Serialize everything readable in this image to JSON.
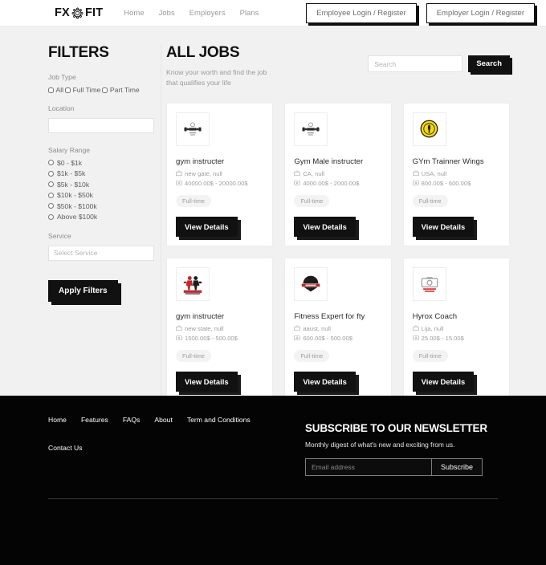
{
  "header": {
    "logo": {
      "left": "FX",
      "right": "FIT",
      "icon": "gear-icon"
    },
    "nav": [
      {
        "label": "Home"
      },
      {
        "label": "Jobs"
      },
      {
        "label": "Employers"
      },
      {
        "label": "Plans"
      }
    ],
    "employee_login": "Employee Login / Register",
    "employer_login": "Employer Login / Register"
  },
  "filters": {
    "title": "FILTERS",
    "job_type_label": "Job Type",
    "job_types": [
      {
        "label": "All",
        "checked": false
      },
      {
        "label": "Full Time",
        "checked": false
      },
      {
        "label": "Part Time",
        "checked": false
      }
    ],
    "location_label": "Location",
    "location_value": "",
    "location_placeholder": "",
    "salary_label": "Salary Range",
    "salary_ranges": [
      {
        "label": "$0 - $1k",
        "selected": false
      },
      {
        "label": "$1k - $5k",
        "selected": false
      },
      {
        "label": "$5k - $10k",
        "selected": false
      },
      {
        "label": "$10k - $50k",
        "selected": false
      },
      {
        "label": "$50k - $100k",
        "selected": false
      },
      {
        "label": "Above $100k",
        "selected": false
      }
    ],
    "service_label": "Service",
    "service_value": "",
    "service_placeholder": "Select Service",
    "apply_label": "Apply Filters"
  },
  "jobs": {
    "title": "ALL JOBS",
    "subtitle": "Know your worth and find the job that qualifies your life",
    "search_value": "",
    "search_placeholder": "Search",
    "search_button": "Search",
    "view_details_label": "View Details",
    "cards": [
      {
        "logo": "dumbbell-icon",
        "logo_style": "dumbbell",
        "title": "gym instructer",
        "location": "new gate, null",
        "salary": "40000.00$ - 20000.00$",
        "tag": "Full-time"
      },
      {
        "logo": "dumbbell-icon",
        "logo_style": "dumbbell",
        "title": "Gym Male instructer",
        "location": "CA, null",
        "salary": "4000.00$ - 2000.00$",
        "tag": "Full-time"
      },
      {
        "logo": "yellow-badge-icon",
        "logo_style": "yellow-badge",
        "title": "GYm Trainner Wings",
        "location": "USA, null",
        "salary": "800.00$ - 600.00$",
        "tag": "Full-time"
      },
      {
        "logo": "red-fitness-figure-icon",
        "logo_style": "red-figure",
        "title": "gym instructer",
        "location": "new state, null",
        "salary": "1500.00$ - 500.00$",
        "tag": "Full-time"
      },
      {
        "logo": "dark-crest-icon",
        "logo_style": "dark-crest",
        "title": "Fitness Expert for fty",
        "location": "aaust, null",
        "salary": "600.00$ - 500.00$",
        "tag": "Full-time"
      },
      {
        "logo": "no-image-available-icon",
        "logo_style": "no-image",
        "title": "Hyrox Coach",
        "location": "Lija, null",
        "salary": "25.00$ - 15.00$",
        "tag": "Full-time"
      }
    ]
  },
  "footer": {
    "links": [
      {
        "label": "Home"
      },
      {
        "label": "Features"
      },
      {
        "label": "FAQs"
      },
      {
        "label": "About"
      },
      {
        "label": "Term and Conditions"
      }
    ],
    "contact": "Contact Us",
    "newsletter_title": "SUBSCRIBE TO OUR NEWSLETTER",
    "newsletter_sub": "Monthly digest of what's new and exciting from us.",
    "email_value": "",
    "email_placeholder": "Email address",
    "subscribe_label": "Subscribe"
  }
}
